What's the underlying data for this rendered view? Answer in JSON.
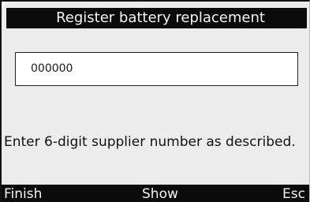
{
  "title": "Register battery replacement",
  "input": {
    "value": "000000"
  },
  "message": "Enter 6-digit supplier number as described.",
  "softkeys": {
    "left": "Finish",
    "center": "Show",
    "right": "Esc"
  },
  "colors": {
    "screen_background": "#ececec",
    "bar_background": "#0b0b0b",
    "bar_text": "#f4f4f4",
    "input_background": "#ffffff"
  }
}
